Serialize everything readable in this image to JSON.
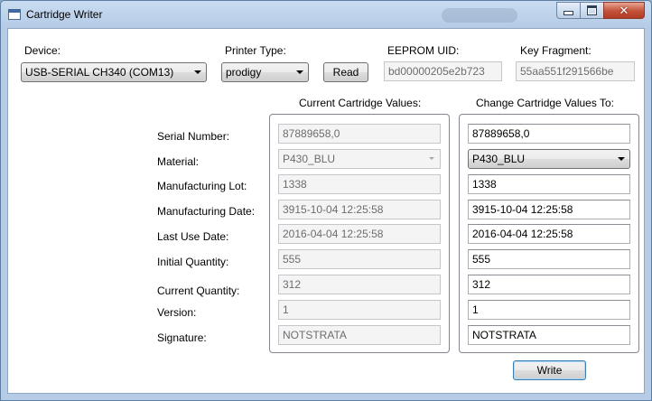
{
  "window": {
    "title": "Cartridge Writer",
    "controls": {
      "minimize_icon": "minimize-icon",
      "maximize_icon": "maximize-icon",
      "close_icon": "close-icon"
    }
  },
  "device": {
    "label": "Device:",
    "value": "USB-SERIAL CH340 (COM13)"
  },
  "printer_type": {
    "label": "Printer Type:",
    "value": "prodigy"
  },
  "read_button": "Read",
  "eeprom_uid": {
    "label": "EEPROM UID:",
    "value": "bd00000205e2b723"
  },
  "key_fragment": {
    "label": "Key Fragment:",
    "value": "55aa551f291566be"
  },
  "current_header": "Current Cartridge Values:",
  "change_header": "Change Cartridge Values To:",
  "fields": [
    {
      "label": "Serial Number:",
      "current": "87889658,0",
      "new": "87889658,0"
    },
    {
      "label": "Material:",
      "current": "P430_BLU",
      "new": "P430_BLU"
    },
    {
      "label": "Manufacturing Lot:",
      "current": "1338",
      "new": "1338"
    },
    {
      "label": "Manufacturing Date:",
      "current": "3915-10-04 12:25:58",
      "new": "3915-10-04 12:25:58"
    },
    {
      "label": "Last Use Date:",
      "current": "2016-04-04 12:25:58",
      "new": "2016-04-04 12:25:58"
    },
    {
      "label": "Initial Quantity:",
      "current": "555",
      "new": "555"
    },
    {
      "label": "Current Quantity:",
      "current": "312",
      "new": "312"
    },
    {
      "label": "Version:",
      "current": "1",
      "new": "1"
    },
    {
      "label": "Signature:",
      "current": "NOTSTRATA",
      "new": "NOTSTRATA"
    }
  ],
  "write_button": "Write"
}
